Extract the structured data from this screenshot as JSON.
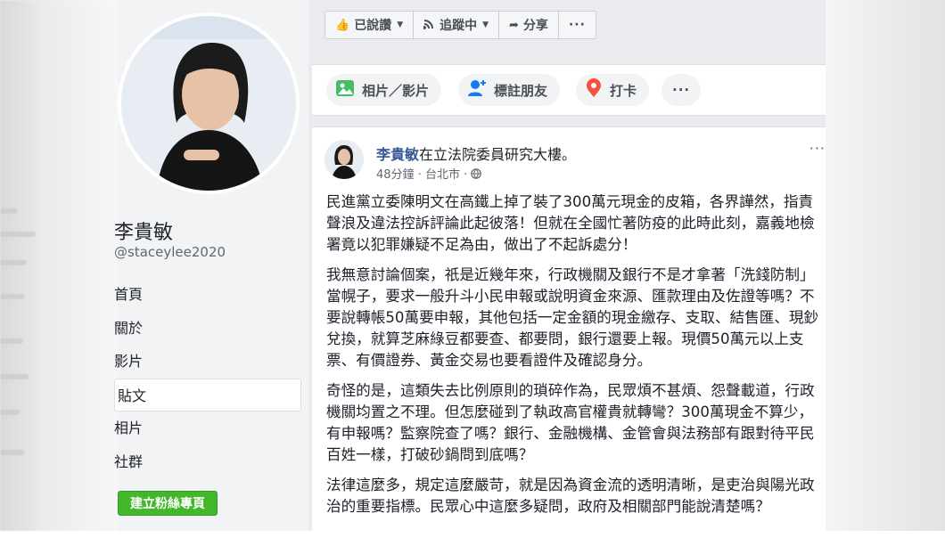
{
  "profile": {
    "name": "李貴敏",
    "handle": "@staceylee2020",
    "nav": [
      "首頁",
      "關於",
      "影片",
      "貼文",
      "相片",
      "社群"
    ],
    "active_nav": "貼文",
    "create_button": "建立粉絲專頁"
  },
  "action_bar": {
    "liked": "已說讚",
    "following": "追蹤中",
    "share": "分享",
    "more": "···"
  },
  "composer": {
    "photo_video": "相片／影片",
    "tag_friends": "標註朋友",
    "check_in": "打卡",
    "more": "···"
  },
  "post": {
    "author": "李貴敏",
    "location_text": "在立法院委員研究大樓。",
    "time": "48分鐘",
    "place": "台北市",
    "more": "···",
    "paragraphs": [
      "民進黨立委陳明文在高鐵上掉了裝了300萬元現金的皮箱，各界譁然，指責聲浪及違法控訴評論此起彼落！但就在全國忙著防疫的此時此刻，嘉義地檢署竟以犯罪嫌疑不足為由，做出了不起訴處分！",
      "我無意討論個案，祇是近幾年來，行政機關及銀行不是才拿著「洗錢防制」當幌子，要求一般升斗小民申報或說明資金來源、匯款理由及佐證等嗎？不要說轉帳50萬要申報，其他包括一定金額的現金繳存、支取、結售匯、現鈔兌換，就算芝麻綠豆都要查、都要問，銀行還要上報。現價50萬元以上支票、有價證券、黃金交易也要看證件及確認身分。",
      "奇怪的是，這類失去比例原則的瑣碎作為，民眾煩不甚煩、怨聲載道，行政機關均置之不理。但怎麼碰到了執政高官權貴就轉彎？300萬現金不算少，有申報嗎？監察院查了嗎？銀行、金融機構、金管會與法務部有跟對待平民百姓一樣，打破砂鍋問到底嗎？",
      "法律這麼多，規定這麼嚴苛，就是因為資金流的透明清晰，是吏治與陽光政治的重要指標。民眾心中這麼多疑問，政府及相關部門能說清楚嗎？"
    ]
  }
}
